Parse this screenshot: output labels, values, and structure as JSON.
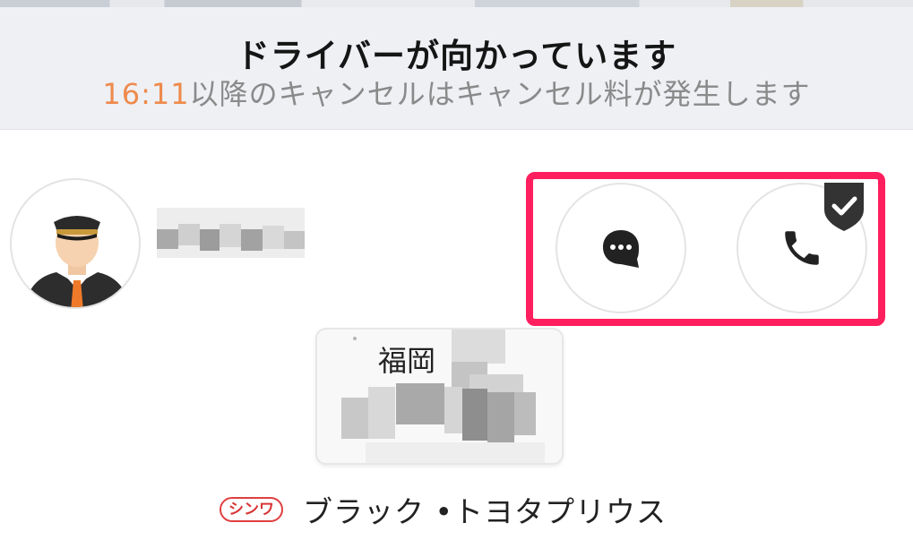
{
  "banner": {
    "title": "ドライバーが向かっています",
    "notice_time": "16:11",
    "notice_text": "以降のキャンセルはキャンセル料が発生します"
  },
  "driver": {
    "avatar_icon": "driver-avatar-icon"
  },
  "contact": {
    "message_icon": "chat-bubble-icon",
    "call_icon": "phone-icon",
    "badge_icon": "check-shield-icon",
    "highlight_color": "#ff1f5e"
  },
  "plate": {
    "region": "福岡"
  },
  "vehicle": {
    "company_badge": "シンワ",
    "description": "ブラック •トヨタプリウス"
  },
  "colors": {
    "accent_time": "#ee8a4c",
    "banner_bg": "#eef0f4",
    "company_red": "#d83535"
  }
}
